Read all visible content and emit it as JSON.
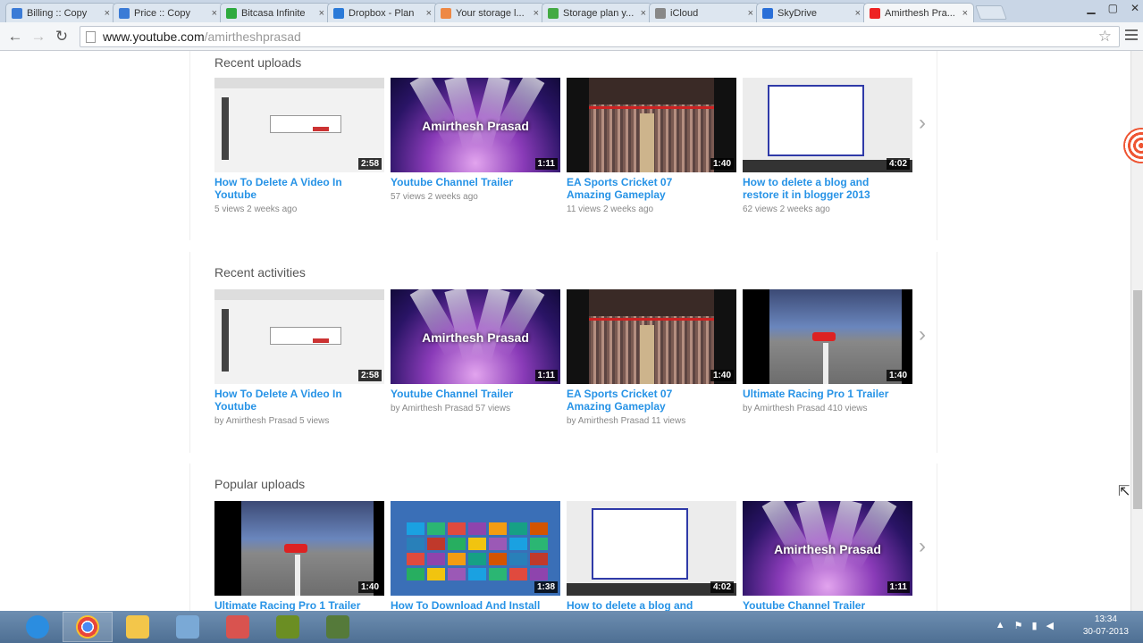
{
  "browser": {
    "tabs": [
      {
        "title": "Billing :: Copy",
        "fav": "#3b7bd6"
      },
      {
        "title": "Price :: Copy",
        "fav": "#3b7bd6"
      },
      {
        "title": "Bitcasa Infinite",
        "fav": "#2eaa3e"
      },
      {
        "title": "Dropbox - Plan",
        "fav": "#2b7ad8"
      },
      {
        "title": "Your storage l...",
        "fav": "#e84"
      },
      {
        "title": "Storage plan y...",
        "fav": "#4a4"
      },
      {
        "title": "iCloud",
        "fav": "#888"
      },
      {
        "title": "SkyDrive",
        "fav": "#2a6fd8"
      },
      {
        "title": "Amirthesh Pra...",
        "fav": "#e22"
      }
    ],
    "close_glyph": "×",
    "url_host": "www.youtube.com",
    "url_path": "/amirtheshprasad"
  },
  "sections": [
    {
      "title": "Recent uploads",
      "videos": [
        {
          "title": "How To Delete A Video In Youtube",
          "duration": "2:58",
          "meta": "5 views   2 weeks ago",
          "thumb": "desk"
        },
        {
          "title": "Youtube Channel Trailer",
          "duration": "1:11",
          "meta": "57 views   2 weeks ago",
          "thumb": "stage"
        },
        {
          "title": "EA Sports Cricket 07 Amazing Gameplay",
          "duration": "1:40",
          "meta": "11 views   2 weeks ago",
          "thumb": "crowd"
        },
        {
          "title": "How to delete a blog and restore it in blogger 2013",
          "duration": "4:02",
          "meta": "62 views   2 weeks ago",
          "thumb": "dialog"
        }
      ]
    },
    {
      "title": "Recent activities",
      "videos": [
        {
          "title": "How To Delete A Video In Youtube",
          "duration": "2:58",
          "meta": "by Amirthesh Prasad   5 views",
          "thumb": "desk"
        },
        {
          "title": "Youtube Channel Trailer",
          "duration": "1:11",
          "meta": "by Amirthesh Prasad   57 views",
          "thumb": "stage"
        },
        {
          "title": "EA Sports Cricket 07 Amazing Gameplay",
          "duration": "1:40",
          "meta": "by Amirthesh Prasad   11 views",
          "thumb": "crowd"
        },
        {
          "title": "Ultimate Racing Pro 1 Trailer",
          "duration": "1:40",
          "meta": "by Amirthesh Prasad   410 views",
          "thumb": "race"
        }
      ]
    },
    {
      "title": "Popular uploads",
      "videos": [
        {
          "title": "Ultimate Racing Pro 1 Trailer",
          "duration": "1:40",
          "meta": "",
          "thumb": "race"
        },
        {
          "title": "How To Download And Install",
          "duration": "1:38",
          "meta": "",
          "thumb": "win"
        },
        {
          "title": "How to delete a blog and",
          "duration": "4:02",
          "meta": "",
          "thumb": "dialog"
        },
        {
          "title": "Youtube Channel Trailer",
          "duration": "1:11",
          "meta": "",
          "thumb": "stage"
        }
      ]
    }
  ],
  "thumb_overlay_text": "Amirthesh Prasad",
  "next_glyph": "›",
  "taskbar": {
    "apps": [
      {
        "name": "internet-explorer",
        "color": "#2b8de0",
        "active": false
      },
      {
        "name": "chrome",
        "color": "#e8453c",
        "active": true
      },
      {
        "name": "file-explorer",
        "color": "#f3c64a",
        "active": false
      },
      {
        "name": "app-4",
        "color": "#7aa9d6",
        "active": false
      },
      {
        "name": "app-5",
        "color": "#d9534f",
        "active": false
      },
      {
        "name": "app-6",
        "color": "#6b8e23",
        "active": false
      },
      {
        "name": "app-7",
        "color": "#557a3a",
        "active": false
      }
    ],
    "time": "13:34",
    "date": "30-07-2013"
  }
}
